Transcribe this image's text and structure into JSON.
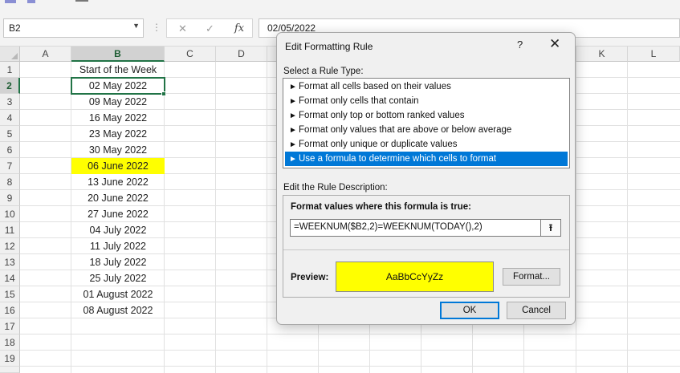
{
  "formula_bar": {
    "name_box": "B2",
    "dropdown_icon": "chevron-down-icon",
    "more_icon": "vertical-ellipsis-icon",
    "cancel_icon": "cross-icon",
    "enter_icon": "check-icon",
    "function_icon": "fx-icon",
    "function_label": "fx",
    "value": "02/05/2022"
  },
  "grid": {
    "columns": [
      "A",
      "B",
      "C",
      "D",
      "K",
      "L"
    ],
    "rows": [
      "1",
      "2",
      "3",
      "4",
      "5",
      "6",
      "7",
      "8",
      "9",
      "10",
      "11",
      "12",
      "13",
      "14",
      "15",
      "16",
      "17",
      "18",
      "19"
    ],
    "b_cells": [
      "Start of the Week",
      "02 May 2022",
      "09 May 2022",
      "16 May 2022",
      "23 May 2022",
      "30 May 2022",
      "06 June 2022",
      "13 June 2022",
      "20 June 2022",
      "27 June 2022",
      "04 July 2022",
      "11 July 2022",
      "18 July 2022",
      "25 July 2022",
      "01 August 2022",
      "08 August 2022"
    ],
    "highlight_color": "#ffff00",
    "selection_color": "#217346"
  },
  "dialog": {
    "title": "Edit Formatting Rule",
    "help_label": "?",
    "close_label": "✕",
    "select_rule_label": "Select a Rule Type:",
    "rule_types": [
      "Format all cells based on their values",
      "Format only cells that contain",
      "Format only top or bottom ranked values",
      "Format only values that are above or below average",
      "Format only unique or duplicate values",
      "Use a formula to determine which cells to format"
    ],
    "selected_rule_index": 5,
    "rule_arrow": "►",
    "edit_desc_label": "Edit the Rule Description:",
    "formula_label": "Format values where this formula is true:",
    "formula_value": "=WEEKNUM($B2,2)=WEEKNUM(TODAY(),2)",
    "collapse_icon": "collapse-dialog-icon",
    "collapse_glyph": "⭱",
    "preview_label": "Preview:",
    "preview_text": "AaBbCcYyZz",
    "preview_color": "#ffff00",
    "format_button": "Format...",
    "ok_button": "OK",
    "cancel_button": "Cancel",
    "accent_color": "#0078d7"
  }
}
